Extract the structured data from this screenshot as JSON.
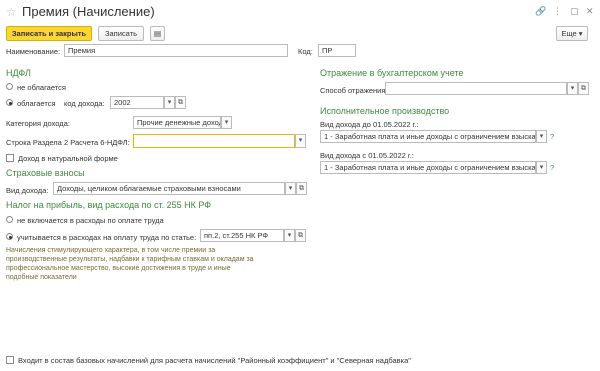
{
  "window": {
    "title": "Премия (Начисление)"
  },
  "toolbar": {
    "save_close": "Записать и закрыть",
    "save": "Записать",
    "more": "Еще"
  },
  "header": {
    "name_label": "Наименование:",
    "name_value": "Премия",
    "code_label": "Код:",
    "code_value": "ПР"
  },
  "ndfl": {
    "section": "НДФЛ",
    "not_taxed": "не облагается",
    "taxed": "облагается",
    "income_code_label": "код дохода:",
    "income_code_value": "2002",
    "category_label": "Категория дохода:",
    "category_value": "Прочие денежные доход",
    "line_label": "Строка Раздела 2 Расчета 6-НДФЛ:",
    "line_value": "",
    "natural_income": "Доход в натуральной форме"
  },
  "insurance": {
    "section": "Страховые взносы",
    "income_type_label": "Вид дохода:",
    "income_type_value": "Доходы, целиком облагаемые страховыми взносами"
  },
  "profit_tax": {
    "section": "Налог на прибыль, вид расхода по ст. 255 НК РФ",
    "not_included": "не включается в расходы по оплате труда",
    "included": "учитывается в расходах на оплату труда по статье:",
    "article_value": "пп.2, ст.255 НК РФ",
    "note": "Начисления стимулирующего характера, в том числе премии за производственные результаты, надбавки к тарифным ставкам и окладам за профессиональное мастерство, высокие достижения в труде и иные подобные показатели"
  },
  "accounting": {
    "section": "Отражение в бухгалтерском учете",
    "method_label": "Способ отражения:",
    "method_value": ""
  },
  "enforcement": {
    "section": "Исполнительное производство",
    "before_label": "Вид дохода до 01.05.2022 г.:",
    "before_value": "1 - Заработная плата и иные доходы с ограничением взыскан",
    "after_label": "Вид дохода с 01.05.2022 г.:",
    "after_value": "1 - Заработная плата и иные доходы с ограничением взыскан",
    "help": "?"
  },
  "footer": {
    "base_accruals": "Входит в состав базовых начислений для расчета начислений \"Районный коэффициент\" и \"Северная надбавка\""
  }
}
